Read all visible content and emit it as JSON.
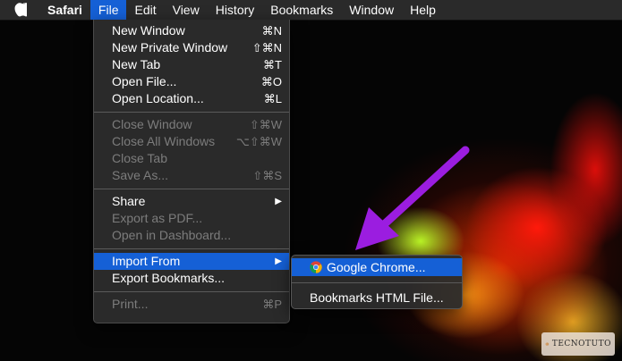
{
  "menubar": {
    "apple_icon": "apple-logo",
    "items": [
      "Safari",
      "File",
      "Edit",
      "View",
      "History",
      "Bookmarks",
      "Window",
      "Help"
    ]
  },
  "file_menu": {
    "group1": [
      {
        "label": "New Window",
        "shortcut": "⌘N"
      },
      {
        "label": "New Private Window",
        "shortcut": "⇧⌘N"
      },
      {
        "label": "New Tab",
        "shortcut": "⌘T"
      },
      {
        "label": "Open File...",
        "shortcut": "⌘O"
      },
      {
        "label": "Open Location...",
        "shortcut": "⌘L"
      }
    ],
    "group2": [
      {
        "label": "Close Window",
        "shortcut": "⇧⌘W"
      },
      {
        "label": "Close All Windows",
        "shortcut": "⌥⇧⌘W"
      },
      {
        "label": "Close Tab",
        "shortcut": ""
      },
      {
        "label": "Save As...",
        "shortcut": "⇧⌘S"
      }
    ],
    "group3": [
      {
        "label": "Share",
        "shortcut": "▶"
      },
      {
        "label": "Export as PDF...",
        "shortcut": ""
      },
      {
        "label": "Open in Dashboard...",
        "shortcut": ""
      }
    ],
    "group4": [
      {
        "label": "Import From",
        "shortcut": "▶"
      },
      {
        "label": "Export Bookmarks...",
        "shortcut": ""
      }
    ],
    "group5": [
      {
        "label": "Print...",
        "shortcut": "⌘P"
      }
    ]
  },
  "import_submenu": {
    "items": [
      {
        "label": "Google Chrome...",
        "icon": "chrome-icon"
      },
      {
        "label": "Bookmarks HTML File..."
      }
    ]
  },
  "watermark": {
    "text": "TECNOTUTO"
  },
  "colors": {
    "highlight": "#1560d6",
    "annotation_arrow": "#9b1de0",
    "menu_bg": "#2c2c2c"
  }
}
